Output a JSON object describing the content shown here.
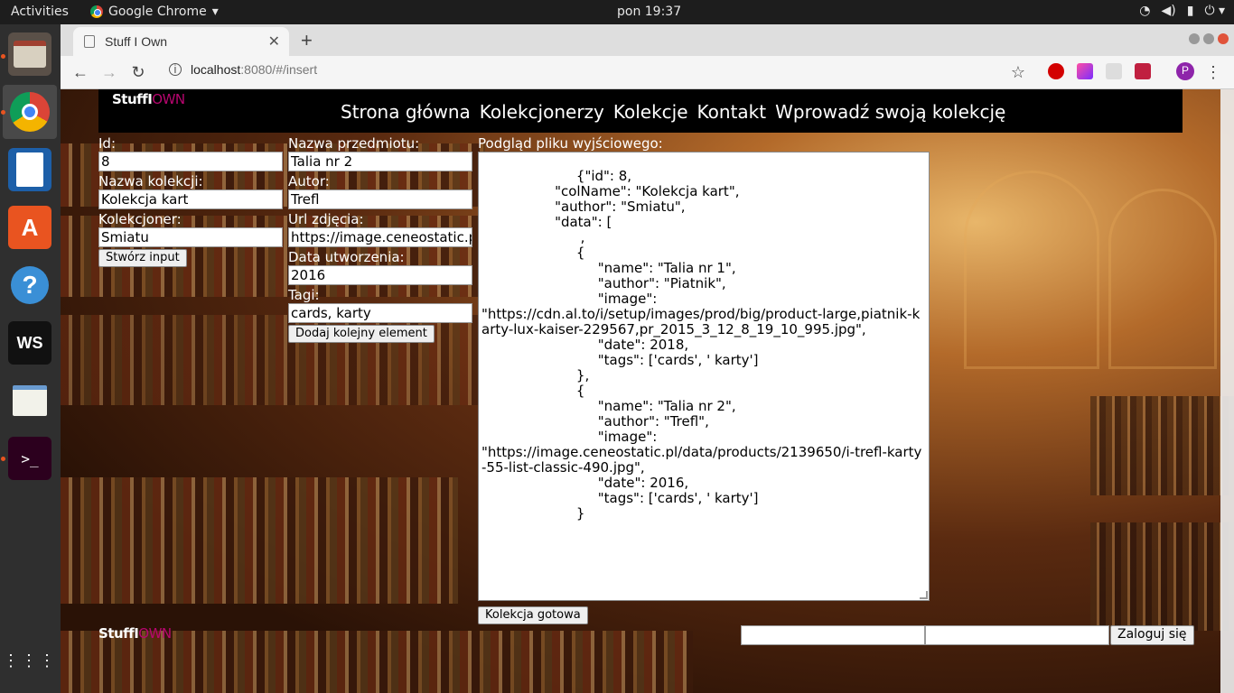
{
  "system": {
    "activities": "Activities",
    "app_name": "Google Chrome",
    "clock": "pon 19:37"
  },
  "browser": {
    "tab_title": "Stuff I Own",
    "url_host": "localhost",
    "url_rest": ":8080/#/insert",
    "profile_initial": "P"
  },
  "app": {
    "logo_main": "StuffI",
    "logo_accent": "OWN",
    "nav": [
      "Strona główna",
      "Kolekcjonerzy",
      "Kolekcje",
      "Kontakt",
      "Wprowadź swoją kolekcję"
    ],
    "form": {
      "id_label": "Id:",
      "id_value": "8",
      "collection_label": "Nazwa kolekcji:",
      "collection_value": "Kolekcja kart",
      "collector_label": "Kolekcjoner:",
      "collector_value": "Smiatu",
      "create_button": "Stwórz input",
      "item_name_label": "Nazwa przedmiotu:",
      "item_name_value": "Talia nr 2",
      "author_label": "Autor:",
      "author_value": "Trefl",
      "image_url_label": "Url zdjęcia:",
      "image_url_value": "https://image.ceneostatic.pl/data/products/2139650/i-trefl-karty-55-list-classic-490.jpg",
      "date_label": "Data utworzenia:",
      "date_value": "2016",
      "tags_label": "Tagi:",
      "tags_value": "cards, karty",
      "add_button": "Dodaj kolejny element",
      "preview_label": "Podgląd pliku wyjściowego:",
      "preview_text": "                {\"id\": 8,\n                 \"colName\": \"Kolekcja kart\",\n                 \"author\": \"Smiatu\",\n                 \"data\": [\n                       ,\n                      {\n                           \"name\": \"Talia nr 1\",\n                           \"author\": \"Piatnik\",\n                           \"image\":\n\"https://cdn.al.to/i/setup/images/prod/big/product-large,piatnik-karty-lux-kaiser-229567,pr_2015_3_12_8_19_10_995.jpg\",\n                           \"date\": 2018,\n                           \"tags\": ['cards', ' karty']\n                      },\n                      {\n                           \"name\": \"Talia nr 2\",\n                           \"author\": \"Trefl\",\n                           \"image\":\n\"https://image.ceneostatic.pl/data/products/2139650/i-trefl-karty-55-list-classic-490.jpg\",\n                           \"date\": 2016,\n                           \"tags\": ['cards', ' karty']\n                      }",
      "finish_button": "Kolekcja gotowa"
    },
    "footer": {
      "login_button": "Zaloguj się"
    }
  }
}
